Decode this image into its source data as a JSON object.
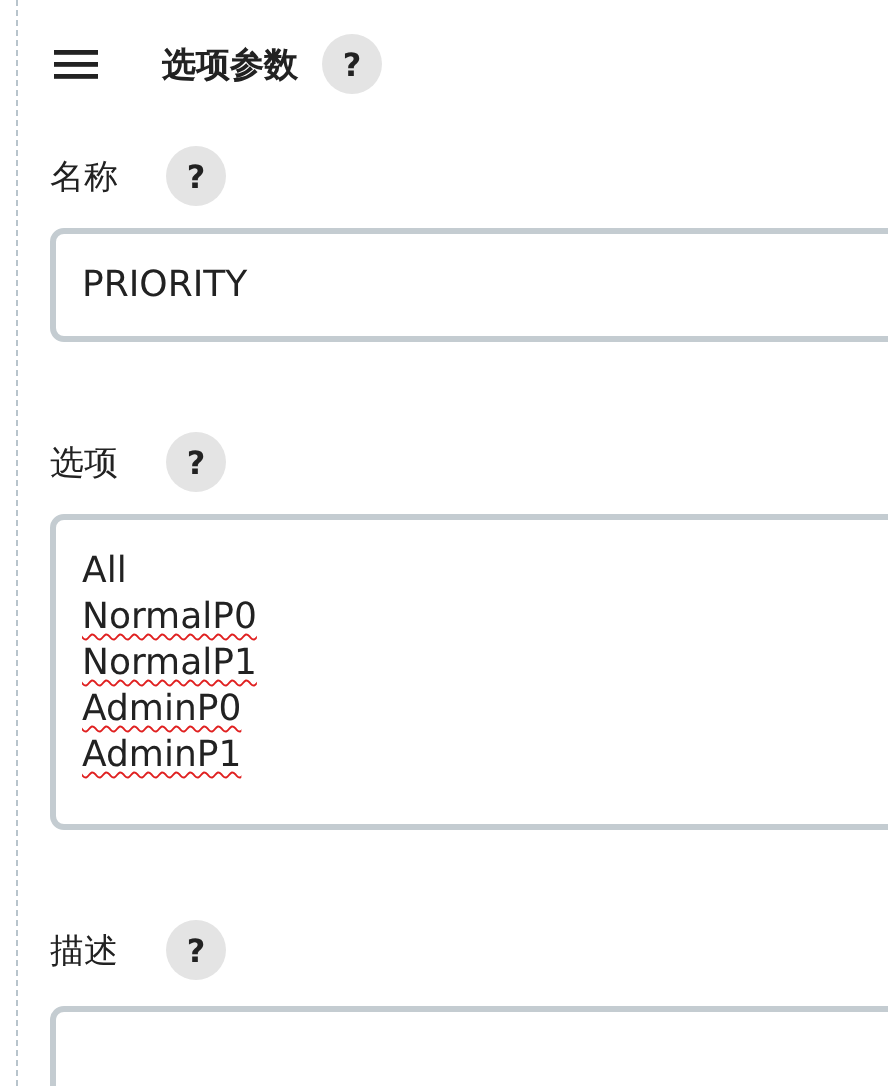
{
  "header": {
    "title": "选项参数",
    "help": "?"
  },
  "fields": [
    {
      "kind": "input",
      "label": "名称",
      "help": "?",
      "value": "PRIORITY"
    },
    {
      "kind": "lines",
      "label": "选项",
      "help": "?",
      "lines": [
        {
          "text": "All",
          "misspelled": false
        },
        {
          "text": "NormalP0",
          "misspelled": true
        },
        {
          "text": "NormalP1",
          "misspelled": true
        },
        {
          "text": "AdminP0",
          "misspelled": true
        },
        {
          "text": "AdminP1",
          "misspelled": true
        }
      ]
    },
    {
      "kind": "empty",
      "label": "描述",
      "help": "?"
    }
  ]
}
